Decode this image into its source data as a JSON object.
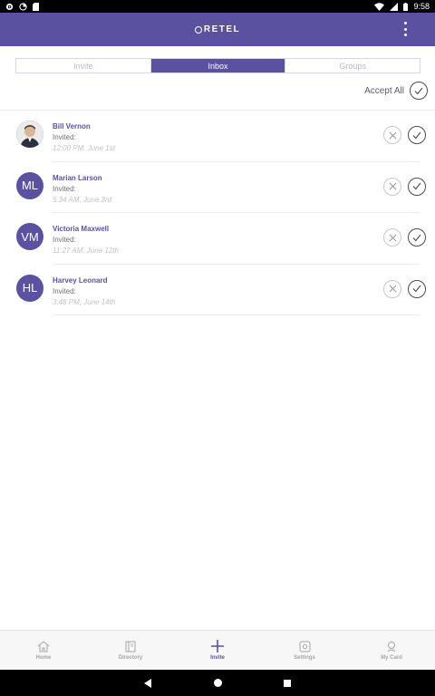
{
  "status_bar": {
    "time": "9:58"
  },
  "app_bar": {
    "logo_text": "RETEL",
    "more_icon": "more-vert-icon"
  },
  "tabs": [
    {
      "label": "Invite",
      "active": false
    },
    {
      "label": "Inbox",
      "active": true
    },
    {
      "label": "Groups",
      "active": false
    }
  ],
  "accept_all": {
    "label": "Accept All"
  },
  "invites": [
    {
      "name": "Bill Vernon",
      "initials": "",
      "status": "Invited:",
      "time": "12:00 PM, June 1st"
    },
    {
      "name": "Marian Larson",
      "initials": "ML",
      "status": "Invited:",
      "time": "5:34 AM, June 3rd"
    },
    {
      "name": "Victoria Maxwell",
      "initials": "VM",
      "status": "Invited:",
      "time": "11:27 AM, June 12th"
    },
    {
      "name": "Harvey Leonard",
      "initials": "HL",
      "status": "Invited:",
      "time": "3:48 PM, June 14th"
    }
  ],
  "bottom_nav": [
    {
      "label": "Home",
      "icon": "home-icon",
      "active": false
    },
    {
      "label": "Directory",
      "icon": "directory-icon",
      "active": false
    },
    {
      "label": "Invite",
      "icon": "plus-icon",
      "active": true
    },
    {
      "label": "Settings",
      "icon": "settings-icon",
      "active": false
    },
    {
      "label": "My Card",
      "icon": "my-card-icon",
      "active": false
    }
  ],
  "colors": {
    "brand": "#5a51a1",
    "muted": "#b9b6cc"
  }
}
